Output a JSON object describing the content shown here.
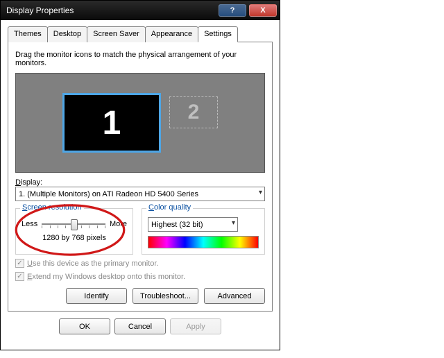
{
  "window": {
    "title": "Display Properties"
  },
  "tabs": [
    "Themes",
    "Desktop",
    "Screen Saver",
    "Appearance",
    "Settings"
  ],
  "active_tab": "Settings",
  "instruction": "Drag the monitor icons to match the physical arrangement of your monitors.",
  "monitors": {
    "primary": "1",
    "secondary": "2"
  },
  "display": {
    "label": "Display:",
    "value": "1. (Multiple Monitors) on ATI Radeon HD 5400 Series"
  },
  "resolution": {
    "legend": "Screen resolution",
    "less": "Less",
    "more": "More",
    "value": "1280 by 768 pixels"
  },
  "color": {
    "legend": "Color quality",
    "value": "Highest (32 bit)"
  },
  "checks": {
    "primary": "Use this device as the primary monitor.",
    "extend": "Extend my Windows desktop onto this monitor."
  },
  "buttons": {
    "identify": "Identify",
    "troubleshoot": "Troubleshoot...",
    "advanced": "Advanced",
    "ok": "OK",
    "cancel": "Cancel",
    "apply": "Apply"
  }
}
